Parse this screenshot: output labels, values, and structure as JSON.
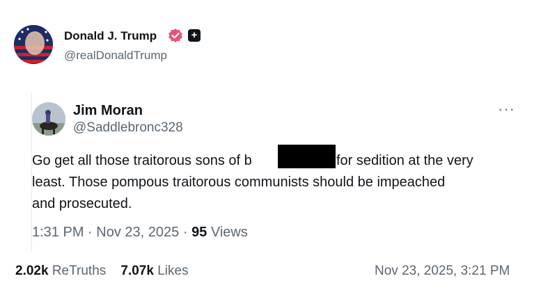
{
  "post": {
    "author_name": "Donald J. Trump",
    "author_handle": "@realDonaldTrump",
    "retruths_count": "2.02k",
    "retruths_label": "ReTruths",
    "likes_count": "7.07k",
    "likes_label": "Likes",
    "date": "Nov 23, 2025, 3:21 PM",
    "verified_badge_color": "#e8527a"
  },
  "quoted": {
    "author_name": "Jim Moran",
    "author_handle": "@Saddlebronc328",
    "line1_a": "Go get all those traitorous sons of b",
    "line1_b": "for sedition at the very",
    "line2": "least.  Those pompous traitorous communists should be impeached",
    "line3": "and prosecuted.",
    "time": "1:31 PM",
    "date": "Nov 23, 2025",
    "views_count": "95",
    "views_label": "Views"
  },
  "icons": {
    "verified": "verified-badge-icon",
    "plus": "plus-badge-icon",
    "more": "more-icon"
  }
}
